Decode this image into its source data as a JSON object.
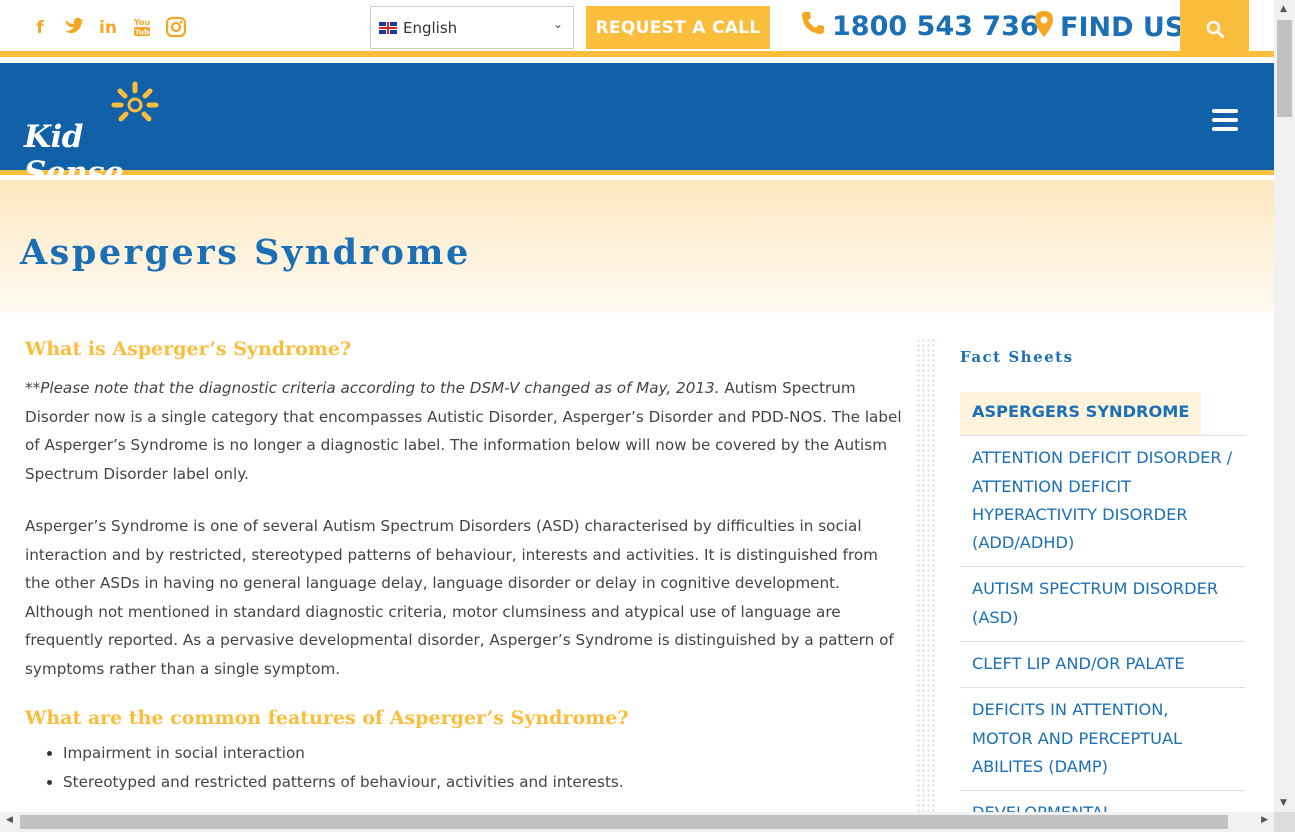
{
  "topbar": {
    "social_icons": [
      "facebook-icon",
      "twitter-icon",
      "linkedin-icon",
      "youtube-icon",
      "instagram-icon"
    ],
    "language": "English",
    "request_button": "REQUEST A CALL",
    "phone": "1800 543 736",
    "find_us": "FIND US"
  },
  "header": {
    "logo_text": "Kid Sense"
  },
  "page": {
    "title": "Aspergers Syndrome"
  },
  "content": {
    "heading1": "What is Asperger’s Syndrome?",
    "note_prefix": "**",
    "note_italic": "Please note that the diagnostic criteria according to the DSM-V changed as of May, 2013.",
    "note_rest": " Autism Spectrum Disorder now is a single category that encompasses Autistic Disorder, Asperger’s Disorder and PDD-NOS. The label of Asperger’s Syndrome is no longer a diagnostic label. The information below will now be covered by the Autism Spectrum Disorder label only.",
    "paragraph2": "Asperger’s Syndrome is one of several Autism Spectrum Disorders (ASD) characterised by difficulties in social interaction and by restricted, stereotyped patterns of behaviour, interests and activities. It is distinguished from the other ASDs in having no general language delay, language disorder or delay in cognitive development. Although not mentioned in standard diagnostic criteria, motor clumsiness and atypical use of language are frequently reported. As a pervasive developmental disorder, Asperger’s Syndrome is distinguished by a pattern of symptoms rather than a single symptom.",
    "heading2": "What are the common features of Asperger’s Syndrome?",
    "features": [
      "Impairment in social interaction",
      "Stereotyped and restricted patterns of behaviour, activities and interests."
    ]
  },
  "sidebar": {
    "title": "Fact Sheets",
    "items": [
      "ASPERGERS SYNDROME",
      "ATTENTION DEFICIT DISORDER / ATTENTION DEFICIT HYPERACTIVITY DISORDER (ADD/ADHD)",
      "AUTISM SPECTRUM DISORDER (ASD)",
      "CLEFT LIP AND/OR PALATE",
      "DEFICITS IN ATTENTION, MOTOR AND PERCEPTUAL ABILITES (DAMP)",
      "DEVELOPMENTAL COORDINATION"
    ]
  },
  "colors": {
    "brand_blue": "#1261a8",
    "link_blue": "#1a6fb5",
    "accent_yellow": "#fbbd3c"
  }
}
